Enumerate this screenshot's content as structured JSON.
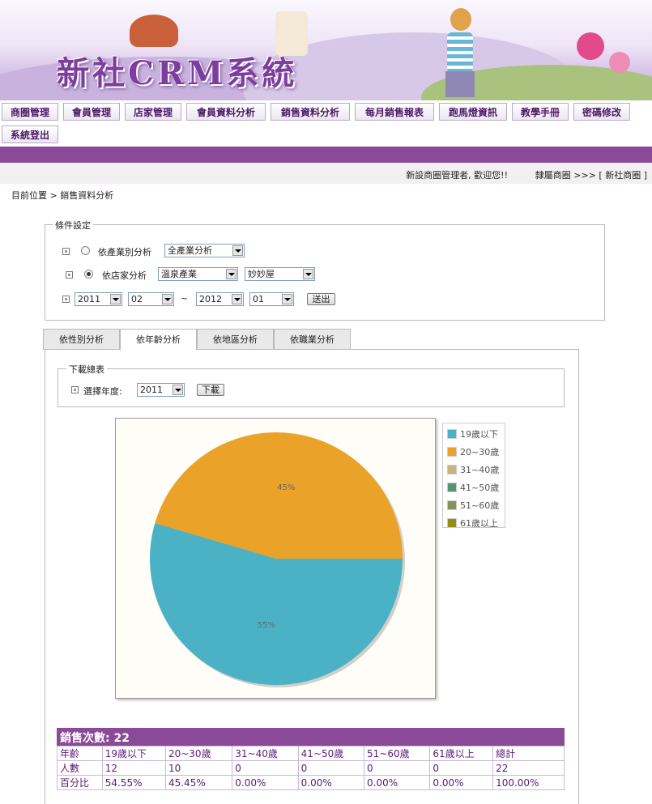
{
  "banner": {
    "title": "新社CRM系統"
  },
  "nav": {
    "items": [
      "商圈管理",
      "會員管理",
      "店家管理",
      "會員資料分析",
      "銷售資料分析",
      "每月銷售報表",
      "跑馬燈資訊",
      "教學手冊",
      "密碼修改",
      "系統登出"
    ]
  },
  "welcome": {
    "greeting": "新設商圈管理者, 歡迎您!!",
    "affiliation": "隸屬商圈 >>> [ 新社商圈 ]"
  },
  "breadcrumb": "目前位置 > 銷售資料分析",
  "conditions": {
    "legend": "條件設定",
    "industry_radio_label": "依產業別分析",
    "industry_select": "全產業分析",
    "store_radio_label": "依店家分析",
    "store_category_select": "溫泉產業",
    "store_select": "妙妙屋",
    "start_year": "2011",
    "start_month": "02",
    "tilde": "~",
    "end_year": "2012",
    "end_month": "01",
    "submit": "送出"
  },
  "tabs": [
    "依性別分析",
    "依年齡分析",
    "依地區分析",
    "依職業分析"
  ],
  "download": {
    "legend": "下載總表",
    "year_label": "選擇年度:",
    "year": "2011",
    "button": "下載"
  },
  "chart_data": {
    "type": "pie",
    "categories": [
      "19歲以下",
      "20~30歲",
      "31~40歲",
      "41~50歲",
      "51~60歲",
      "61歲以上"
    ],
    "values": [
      12,
      10,
      0,
      0,
      0,
      0
    ],
    "slice_labels": [
      "55%",
      "45%"
    ],
    "colors": [
      "#4bb2c5",
      "#eaa228",
      "#c5b47f",
      "#579575",
      "#839557",
      "#958c12"
    ],
    "legend_position": "right"
  },
  "stats": {
    "caption": "銷售次數: 22",
    "rows": [
      [
        "年齡",
        "19歲以下",
        "20~30歲",
        "31~40歲",
        "41~50歲",
        "51~60歲",
        "61歲以上",
        "總計"
      ],
      [
        "人數",
        "12",
        "10",
        "0",
        "0",
        "0",
        "0",
        "22"
      ],
      [
        "百分比",
        "54.55%",
        "45.45%",
        "0.00%",
        "0.00%",
        "0.00%",
        "0.00%",
        "100.00%"
      ]
    ]
  }
}
